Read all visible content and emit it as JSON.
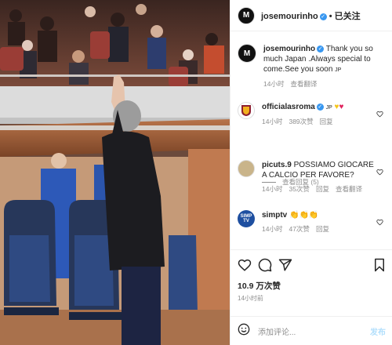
{
  "colors": {
    "accent": "#3897f0",
    "muted": "#8e8e8e",
    "heart_yellow": "#f5c518",
    "heart_red": "#e0245e"
  },
  "post": {
    "author": "josemourinho",
    "avatar_text": "M",
    "follow_label": "已关注",
    "likes": "10.9 万次赞",
    "time": "14小时前",
    "add_comment_placeholder": "添加评论...",
    "post_button": "发布"
  },
  "caption": {
    "username": "josemourinho",
    "text": "Thank you so much Japan .Always special to come.See you soon",
    "flag": "JP",
    "time": "14小时",
    "translate": "查看翻译"
  },
  "comments": [
    {
      "username": "officialasroma",
      "text": "JP",
      "time": "14小时",
      "likes": "389次赞",
      "reply": "回复",
      "translate": ""
    },
    {
      "username": "picuts.9",
      "text": "POSSIAMO GIOCARE A CALCIO PER FAVORE?",
      "time": "14小时",
      "likes": "35次赞",
      "reply": "回复",
      "translate": "查看翻译"
    },
    {
      "username": "simptv",
      "text": "👏👏👏",
      "time": "14小时",
      "likes": "47次赞",
      "reply": "回复",
      "translate": ""
    }
  ],
  "view_replies": "查看回复 (5)",
  "icons": {
    "like": "heart-icon",
    "comment": "comment-icon",
    "share": "share-icon",
    "save": "bookmark-icon",
    "emoji": "emoji-icon",
    "verified": "verified-badge-icon"
  }
}
